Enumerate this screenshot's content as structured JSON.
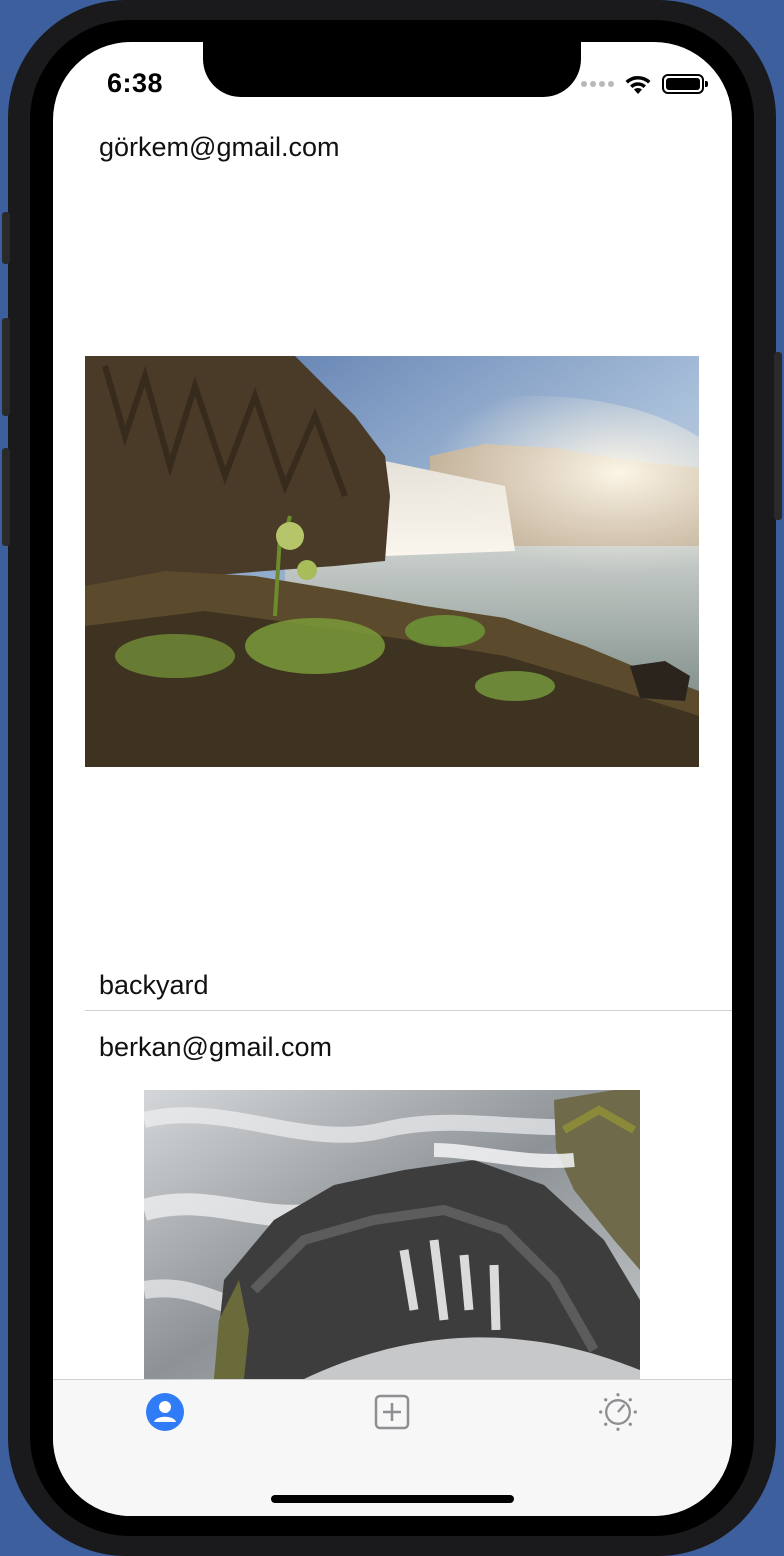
{
  "status_bar": {
    "time": "6:38",
    "icons": [
      "signal-dots-icon",
      "wifi-icon",
      "battery-icon"
    ]
  },
  "feed": {
    "posts": [
      {
        "email": "görkem@gmail.com",
        "image": "waterfall-landscape-photo",
        "caption": "backyard"
      },
      {
        "email": "berkan@gmail.com",
        "image": "water-over-rocks-photo",
        "caption": ""
      }
    ]
  },
  "tab_bar": {
    "items": [
      {
        "name": "feed",
        "icon": "person-circle-icon",
        "active": true
      },
      {
        "name": "upload",
        "icon": "plus-square-icon",
        "active": false
      },
      {
        "name": "settings",
        "icon": "gauge-icon",
        "active": false
      }
    ],
    "active_color": "#2f7cf6",
    "inactive_color": "#8e8e93"
  }
}
